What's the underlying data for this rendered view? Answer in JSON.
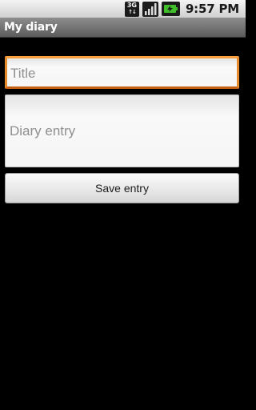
{
  "status_bar": {
    "network_type": "3G",
    "clock": "9:57 PM",
    "icons": [
      "network-3g-icon",
      "signal-strength-icon",
      "battery-charging-icon"
    ]
  },
  "app": {
    "title": "My diary"
  },
  "form": {
    "title_placeholder": "Title",
    "entry_placeholder": "Diary entry",
    "save_label": "Save entry"
  },
  "colors": {
    "focus_accent": "#f08c1e",
    "title_bar": "#6e6e6e",
    "background": "#000000"
  }
}
